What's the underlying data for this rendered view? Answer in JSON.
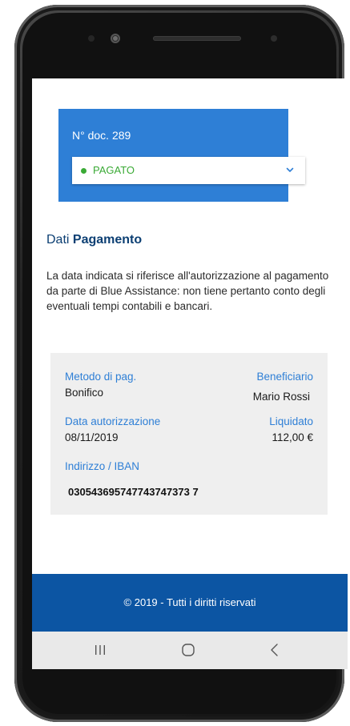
{
  "document": {
    "number_label": "N° doc. 289",
    "status": {
      "label": "PAGATO",
      "dot_color": "#3aaa35"
    }
  },
  "section": {
    "title_prefix": "Dati",
    "title_bold": "Pagamento",
    "description": "La data indicata si riferisce all'autorizzazione al pagamento da parte di Blue Assistance: non tiene pertanto conto degli eventuali tempi contabili e bancari."
  },
  "details": {
    "payment_method_label": "Metodo di pag.",
    "payment_method_value": "Bonifico",
    "beneficiary_label": "Beneficiario",
    "beneficiary_value": "Mario Rossi",
    "authorization_date_label": "Data autorizzazione",
    "authorization_date_value": "08/11/2019",
    "paid_label": "Liquidato",
    "paid_value": "112,00 €",
    "iban_label": "Indirizzo / IBAN",
    "iban_value": "030543695747743747373 7"
  },
  "footer": {
    "copyright": "© 2019 - Tutti i diritti riservati"
  },
  "navbar": {
    "icons": [
      "recent-apps-icon",
      "home-icon",
      "back-icon"
    ]
  },
  "colors": {
    "accent": "#2e7fd6",
    "footer_bg": "#0c55a3",
    "title_dark": "#0c3f73",
    "status_green": "#3aaa35"
  }
}
